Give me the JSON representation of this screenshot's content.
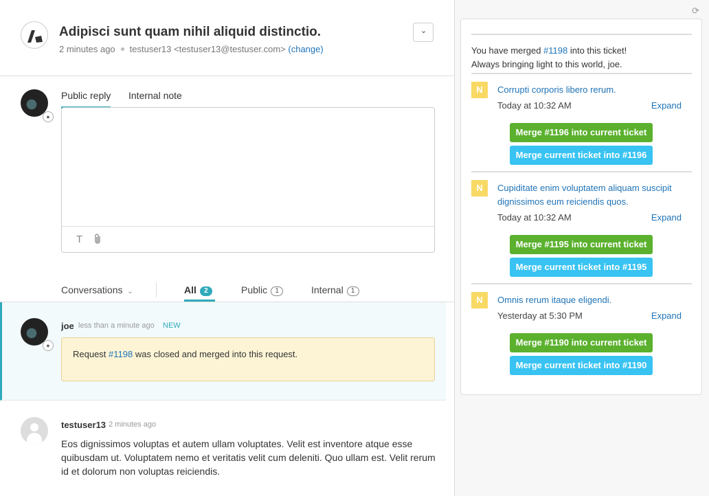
{
  "ticket": {
    "title": "Adipisci sunt quam nihil aliquid distinctio.",
    "time": "2 minutes ago",
    "requester": "testuser13 <testuser13@testuser.com>",
    "change_link": "(change)",
    "menu_icon": "chevron-down-icon"
  },
  "reply": {
    "tabs": [
      "Public reply",
      "Internal note"
    ],
    "toolbar": {
      "text_icon": "T",
      "attach_icon": "paperclip-icon"
    }
  },
  "conversations": {
    "label": "Conversations",
    "filters": [
      {
        "label": "All",
        "count": "2"
      },
      {
        "label": "Public",
        "count": "1"
      },
      {
        "label": "Internal",
        "count": "1"
      }
    ]
  },
  "events": [
    {
      "author": "joe",
      "time": "less than a minute ago",
      "badge": "NEW",
      "notice_prefix": "Request ",
      "notice_link": "#1198",
      "notice_suffix": " was closed and merged into this request."
    },
    {
      "author": "testuser13",
      "time": "2 minutes ago",
      "body": "Eos dignissimos voluptas et autem ullam voluptates. Velit est inventore atque esse quibusdam ut. Voluptatem nemo et veritatis velit cum deleniti. Quo ullam est. Velit rerum id et dolorum non voluptas reiciendis."
    }
  ],
  "sidebar": {
    "merged_prefix": "You have merged ",
    "merged_link": "#1198",
    "merged_suffix": " into this ticket!",
    "merged_line2": "Always bringing light to this world, joe.",
    "items": [
      {
        "badge": "N",
        "title": "Corrupti corporis libero rerum.",
        "date": "Today at 10:32 AM",
        "expand": "Expand",
        "merge_into_current": "Merge #1196 into current ticket",
        "merge_current_into": "Merge current ticket into #1196"
      },
      {
        "badge": "N",
        "title": "Cupiditate enim voluptatem aliquam suscipit dignissimos eum reiciendis quos.",
        "date": "Today at 10:32 AM",
        "expand": "Expand",
        "merge_into_current": "Merge #1195 into current ticket",
        "merge_current_into": "Merge current ticket into #1195"
      },
      {
        "badge": "N",
        "title": "Omnis rerum itaque eligendi.",
        "date": "Yesterday at 5:30 PM",
        "expand": "Expand",
        "merge_into_current": "Merge #1190 into current ticket",
        "merge_current_into": "Merge current ticket into #1190"
      }
    ]
  },
  "colors": {
    "accent": "#30aabc",
    "link": "#1f73b7",
    "merge_green": "#5bb12e",
    "merge_blue": "#38c3f2",
    "notice_bg": "#fdf4d5"
  }
}
